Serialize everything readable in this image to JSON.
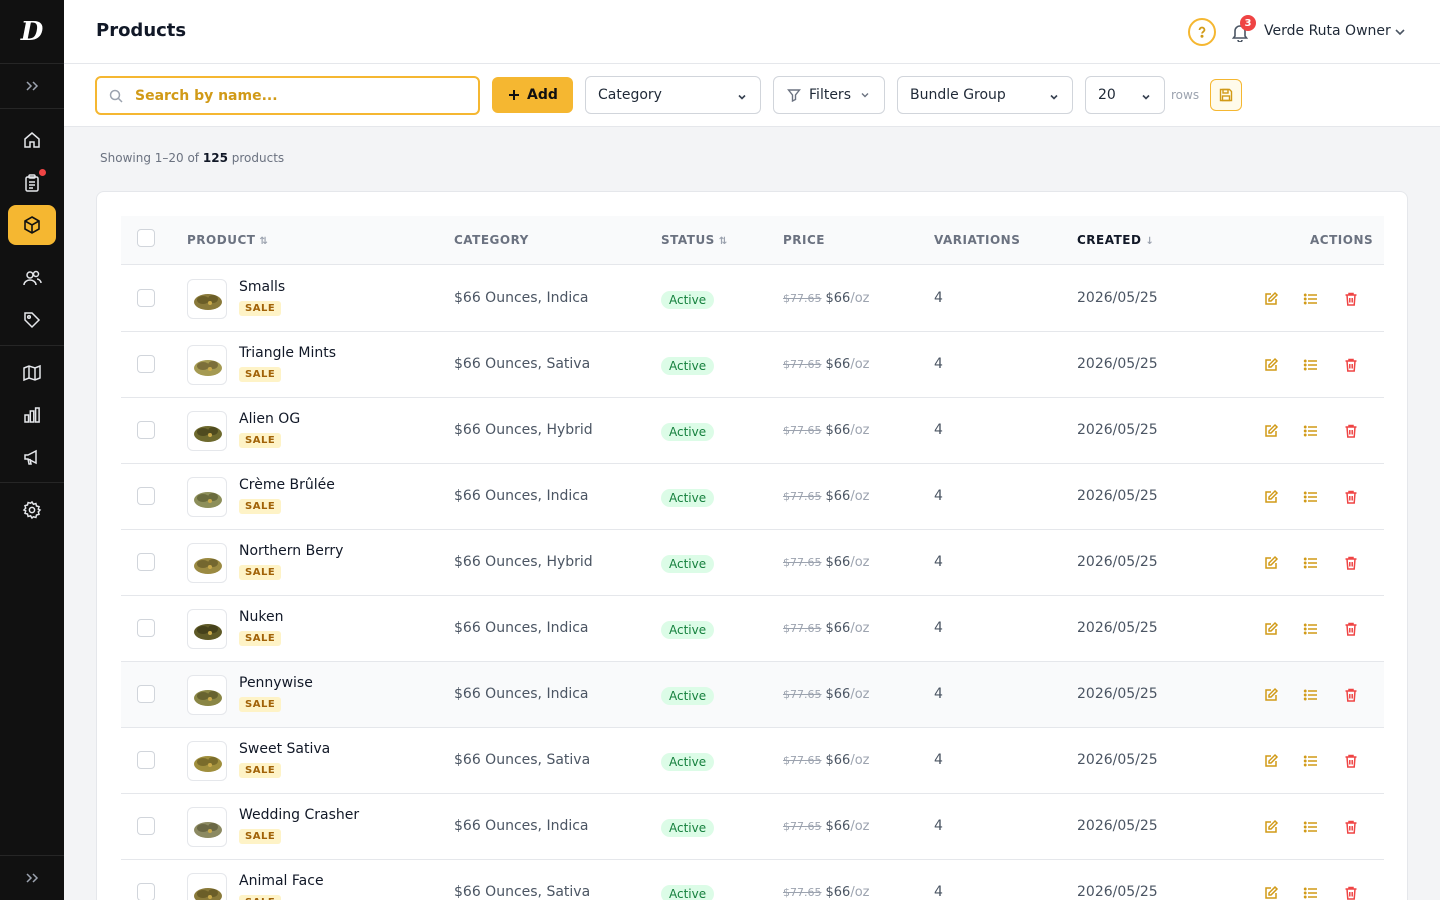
{
  "brand": {
    "logo_letter": "D"
  },
  "header": {
    "title": "Products",
    "notifications_count": "3",
    "user_name": "Verde Ruta Owner"
  },
  "toolbar": {
    "search_placeholder": "Search by name...",
    "add_label": "Add",
    "category_label": "Category",
    "filters_label": "Filters",
    "bundle_group_label": "Bundle Group",
    "rows_value": "20",
    "rows_label": "rows"
  },
  "summary": {
    "prefix": "Showing 1–20 of",
    "total": "125",
    "suffix": "products"
  },
  "table": {
    "columns": {
      "product": "PRODUCT",
      "category": "CATEGORY",
      "status": "STATUS",
      "price": "PRICE",
      "variations": "VARIATIONS",
      "created": "CREATED",
      "actions": "ACTIONS"
    },
    "rows": [
      {
        "name": "Smalls",
        "badge": "SALE",
        "category": "$66 Ounces, Indica",
        "status": "Active",
        "old_price": "$77.65",
        "price": "$66",
        "unit": "/oz",
        "variations": "4",
        "created": "2026/05/25"
      },
      {
        "name": "Triangle Mints",
        "badge": "SALE",
        "category": "$66 Ounces, Sativa",
        "status": "Active",
        "old_price": "$77.65",
        "price": "$66",
        "unit": "/oz",
        "variations": "4",
        "created": "2026/05/25"
      },
      {
        "name": "Alien OG",
        "badge": "SALE",
        "category": "$66 Ounces, Hybrid",
        "status": "Active",
        "old_price": "$77.65",
        "price": "$66",
        "unit": "/oz",
        "variations": "4",
        "created": "2026/05/25"
      },
      {
        "name": "Crème Brûlée",
        "badge": "SALE",
        "category": "$66 Ounces, Indica",
        "status": "Active",
        "old_price": "$77.65",
        "price": "$66",
        "unit": "/oz",
        "variations": "4",
        "created": "2026/05/25"
      },
      {
        "name": "Northern Berry",
        "badge": "SALE",
        "category": "$66 Ounces, Hybrid",
        "status": "Active",
        "old_price": "$77.65",
        "price": "$66",
        "unit": "/oz",
        "variations": "4",
        "created": "2026/05/25"
      },
      {
        "name": "Nuken",
        "badge": "SALE",
        "category": "$66 Ounces, Indica",
        "status": "Active",
        "old_price": "$77.65",
        "price": "$66",
        "unit": "/oz",
        "variations": "4",
        "created": "2026/05/25"
      },
      {
        "name": "Pennywise",
        "badge": "SALE",
        "category": "$66 Ounces, Indica",
        "status": "Active",
        "old_price": "$77.65",
        "price": "$66",
        "unit": "/oz",
        "variations": "4",
        "created": "2026/05/25"
      },
      {
        "name": "Sweet Sativa",
        "badge": "SALE",
        "category": "$66 Ounces, Sativa",
        "status": "Active",
        "old_price": "$77.65",
        "price": "$66",
        "unit": "/oz",
        "variations": "4",
        "created": "2026/05/25"
      },
      {
        "name": "Wedding Crasher",
        "badge": "SALE",
        "category": "$66 Ounces, Indica",
        "status": "Active",
        "old_price": "$77.65",
        "price": "$66",
        "unit": "/oz",
        "variations": "4",
        "created": "2026/05/25"
      },
      {
        "name": "Animal Face",
        "badge": "SALE",
        "category": "$66 Ounces, Sativa",
        "status": "Active",
        "old_price": "$77.65",
        "price": "$66",
        "unit": "/oz",
        "variations": "4",
        "created": "2026/05/25"
      }
    ]
  },
  "sidebar": {
    "items": [
      {
        "icon": "home-icon",
        "active": false
      },
      {
        "icon": "clipboard-icon",
        "active": false,
        "dot": true
      },
      {
        "icon": "box-icon",
        "active": true
      },
      {
        "icon": "users-icon",
        "active": false
      },
      {
        "icon": "tag-icon",
        "active": false
      },
      {
        "icon": "map-icon",
        "active": false
      },
      {
        "icon": "bar-chart-icon",
        "active": false
      },
      {
        "icon": "megaphone-icon",
        "active": false
      },
      {
        "icon": "gear-icon",
        "active": false
      }
    ]
  },
  "colors": {
    "accent": "#f5b731",
    "sidebar_bg": "#111111",
    "active_green": "#15803d",
    "danger": "#ef4444"
  }
}
